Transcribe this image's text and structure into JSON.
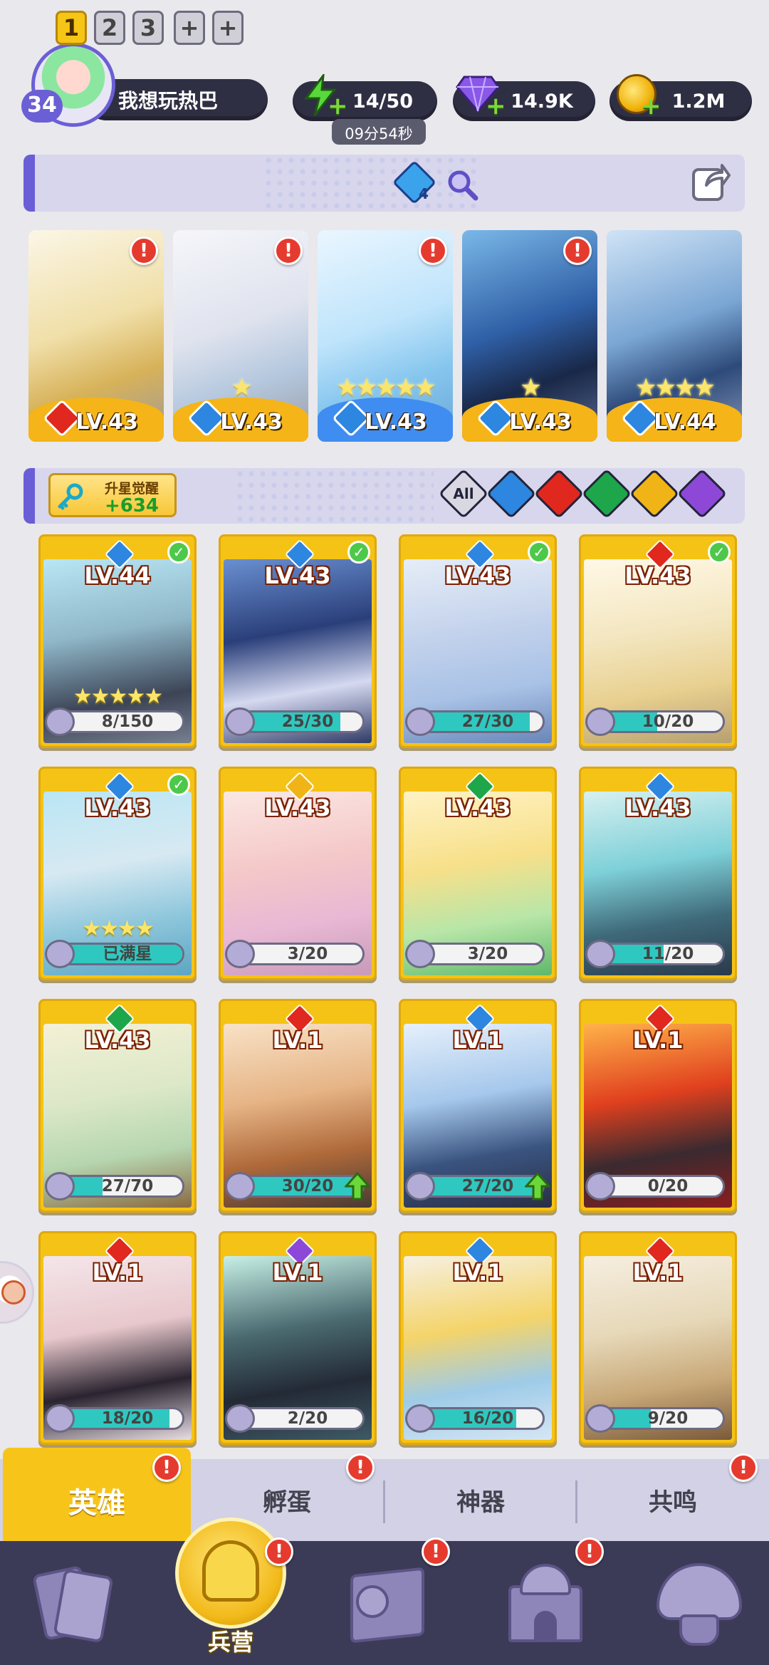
{
  "player": {
    "level": "34",
    "name": "我想玩热巴"
  },
  "resources": {
    "energy": "14/50",
    "energy_timer": "09分54秒",
    "gems": "14.9K",
    "coins": "1.2M"
  },
  "team_tabs": [
    "1",
    "2",
    "3",
    "+",
    "+"
  ],
  "team_tab_active": 0,
  "team_crystal_count": "4",
  "team_heroes": [
    {
      "level": "LV.43",
      "element": "fire",
      "stars": "",
      "badge": "!"
    },
    {
      "level": "LV.43",
      "element": "water",
      "stars": "★",
      "badge": "!"
    },
    {
      "level": "LV.43",
      "element": "water",
      "stars": "★★★★★",
      "badge": "!"
    },
    {
      "level": "LV.43",
      "element": "water",
      "stars": "★",
      "badge": "!"
    },
    {
      "level": "LV.44",
      "element": "water",
      "stars": "★★★★",
      "badge": ""
    }
  ],
  "awaken": {
    "label": "升星觉醒",
    "value": "+634"
  },
  "filters": [
    {
      "name": "all",
      "label": "All"
    },
    {
      "name": "water",
      "label": ""
    },
    {
      "name": "fire",
      "label": ""
    },
    {
      "name": "wind",
      "label": ""
    },
    {
      "name": "light",
      "label": ""
    },
    {
      "name": "dark",
      "label": ""
    }
  ],
  "heroes": [
    {
      "level": "LV.44",
      "element": "water",
      "progress": "8/150",
      "fill": 0.05,
      "check": true,
      "stars": "★★★★★"
    },
    {
      "level": "LV.43",
      "element": "water",
      "progress": "25/30",
      "fill": 0.83,
      "check": true,
      "stars": ""
    },
    {
      "level": "LV.43",
      "element": "water",
      "progress": "27/30",
      "fill": 0.9,
      "check": true,
      "stars": ""
    },
    {
      "level": "LV.43",
      "element": "fire",
      "progress": "10/20",
      "fill": 0.5,
      "check": true,
      "stars": ""
    },
    {
      "level": "LV.43",
      "element": "water",
      "progress": "已满星",
      "fill": 1.0,
      "check": true,
      "stars": "★★★★"
    },
    {
      "level": "LV.43",
      "element": "light",
      "progress": "3/20",
      "fill": 0.15,
      "check": false,
      "stars": ""
    },
    {
      "level": "LV.43",
      "element": "wind",
      "progress": "3/20",
      "fill": 0.15,
      "check": false,
      "stars": ""
    },
    {
      "level": "LV.43",
      "element": "water",
      "progress": "11/20",
      "fill": 0.55,
      "check": false,
      "stars": ""
    },
    {
      "level": "LV.43",
      "element": "wind",
      "progress": "27/70",
      "fill": 0.39,
      "check": false,
      "stars": ""
    },
    {
      "level": "LV.1",
      "element": "fire",
      "progress": "30/20",
      "fill": 1.0,
      "check": false,
      "stars": "",
      "upgrade": true
    },
    {
      "level": "LV.1",
      "element": "water",
      "progress": "27/20",
      "fill": 1.0,
      "check": false,
      "stars": "",
      "upgrade": true
    },
    {
      "level": "LV.1",
      "element": "fire",
      "progress": "0/20",
      "fill": 0.0,
      "check": false,
      "stars": ""
    },
    {
      "level": "LV.1",
      "element": "fire",
      "progress": "18/20",
      "fill": 0.9,
      "check": false,
      "stars": ""
    },
    {
      "level": "LV.1",
      "element": "dark",
      "progress": "2/20",
      "fill": 0.1,
      "check": false,
      "stars": ""
    },
    {
      "level": "LV.1",
      "element": "water",
      "progress": "16/20",
      "fill": 0.8,
      "check": false,
      "stars": ""
    },
    {
      "level": "LV.1",
      "element": "fire",
      "progress": "9/20",
      "fill": 0.45,
      "check": false,
      "stars": ""
    }
  ],
  "subtabs": [
    "英雄",
    "孵蛋",
    "神器",
    "共鸣"
  ],
  "subtab_active": 0,
  "nav": [
    {
      "name": "cards",
      "label": ""
    },
    {
      "name": "barracks",
      "label": "兵营"
    },
    {
      "name": "map",
      "label": ""
    },
    {
      "name": "temple",
      "label": ""
    },
    {
      "name": "mushroom",
      "label": ""
    }
  ],
  "badge_mark": "!",
  "colors": {
    "fire": "#e0281f",
    "water": "#2d86e0",
    "wind": "#1ea64a",
    "light": "#f1b417",
    "dark": "#8d48d8",
    "accent_yellow": "#f6c516",
    "nav_bg": "#3b3b58"
  }
}
